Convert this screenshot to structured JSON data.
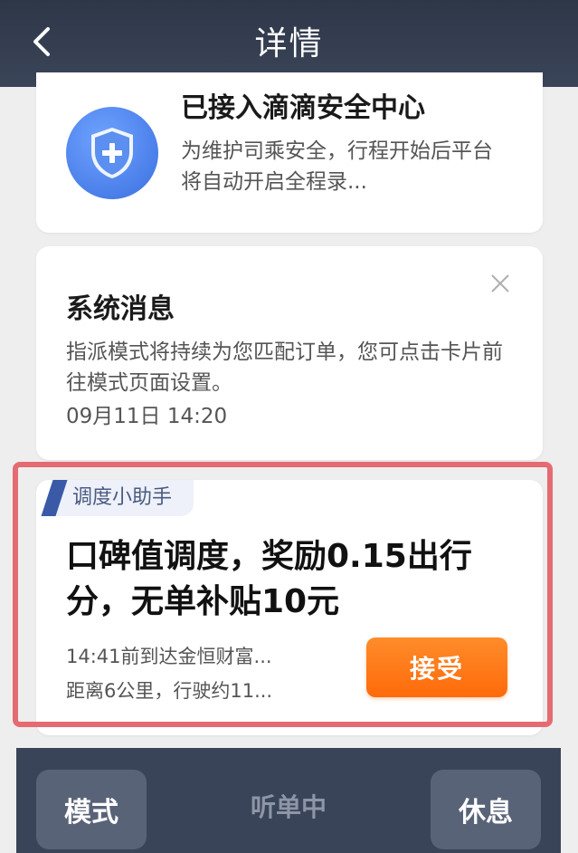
{
  "header": {
    "title": "详情",
    "back_icon": "chevron-left-icon"
  },
  "safety_card": {
    "title": "已接入滴滴安全中心",
    "description": "为维护司乘安全，行程开始后平台将自动开启全程录...",
    "icon": "shield-plus-icon",
    "accent_color": "#3a6fe0"
  },
  "system_card": {
    "title": "系统消息",
    "description": "指派模式将持续为您匹配订单，您可点击卡片前往模式页面设置。",
    "time": "09月11日 14:20",
    "close_icon": "close-icon"
  },
  "dispatch_card": {
    "tag": "调度小助手",
    "title": "口碑值调度，奖励0.15出行分，无单补贴10元",
    "info_line1": "14:41前到达金恒财富...",
    "info_line2": "距离6公里，行驶约11...",
    "accept_label": "接受",
    "accent_color": "#ff6a0a"
  },
  "bottom_bar": {
    "mode_label": "模式",
    "status": "听单中",
    "rest_label": "休息"
  }
}
